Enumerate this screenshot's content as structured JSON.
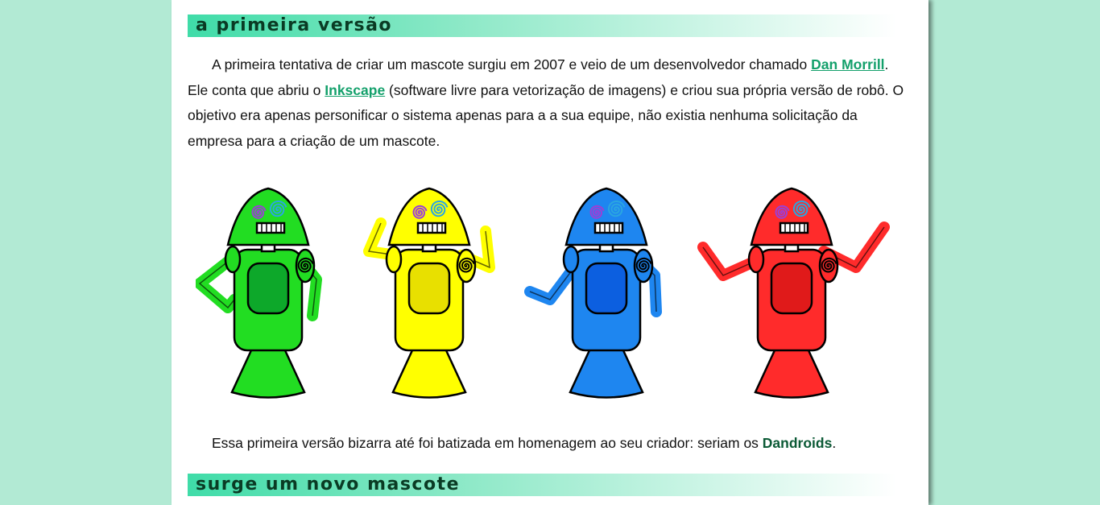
{
  "section1": {
    "heading": "a primeira versão",
    "paragraph": {
      "t1": "A primeira tentativa de criar um mascote surgiu em 2007 e veio de um desenvolvedor chamado ",
      "link1": "Dan Morrill",
      "t2": ". Ele conta que abriu o ",
      "link2": "Inkscape",
      "t3": " (software livre para vetorização de imagens) e criou sua própria versão de robô. O objetivo era apenas personificar o sistema apenas para a a sua equipe, não existia nenhuma solicitação da empresa para a criação de um mascote."
    },
    "figure": {
      "robots": [
        {
          "name": "green",
          "color": "#22dd22",
          "dark": "#0da82a"
        },
        {
          "name": "yellow",
          "color": "#ffff00",
          "dark": "#e8e000"
        },
        {
          "name": "blue",
          "color": "#1e86f0",
          "dark": "#0c5fe0"
        },
        {
          "name": "red",
          "color": "#ff2b2b",
          "dark": "#e01a1a"
        }
      ]
    },
    "closing": {
      "t1": "Essa primeira versão bizarra até foi batizada em homenagem ao seu criador: seriam os ",
      "strong": "Dandroids",
      "t2": "."
    }
  },
  "section2": {
    "heading": "surge um novo mascote"
  },
  "colors": {
    "background": "#b2ead4",
    "heading_gradient_start": "#3fdca8",
    "link": "#13a06b",
    "emphasis": "#0c5a36"
  }
}
